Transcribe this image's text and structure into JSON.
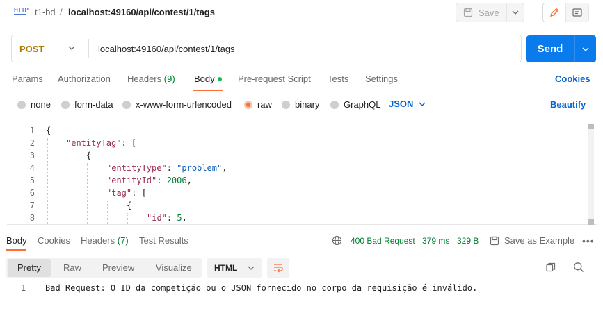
{
  "breadcrumb": {
    "icon_text": "HTTP",
    "collection": "t1-bd",
    "separator": "/",
    "request_url": "localhost:49160/api/contest/1/tags"
  },
  "toolbar": {
    "save_label": "Save"
  },
  "request": {
    "method": "POST",
    "url": "localhost:49160/api/contest/1/tags",
    "send_label": "Send"
  },
  "request_tabs": [
    {
      "label": "Params"
    },
    {
      "label": "Authorization"
    },
    {
      "label": "Headers",
      "count": "(9)"
    },
    {
      "label": "Body",
      "active": true
    },
    {
      "label": "Pre-request Script"
    },
    {
      "label": "Tests"
    },
    {
      "label": "Settings"
    }
  ],
  "cookies_label": "Cookies",
  "body_modes": [
    "none",
    "form-data",
    "x-www-form-urlencoded",
    "raw",
    "binary",
    "GraphQL"
  ],
  "body_mode_selected": "raw",
  "body_format": "JSON",
  "beautify_label": "Beautify",
  "editor": {
    "line_numbers": [
      "1",
      "2",
      "3",
      "4",
      "5",
      "6",
      "7",
      "8"
    ],
    "lines": [
      {
        "parts": [
          {
            "t": "{",
            "c": ""
          }
        ]
      },
      {
        "parts": [
          {
            "t": "\"entityTag\"",
            "c": "k"
          },
          {
            "t": ": [",
            "c": ""
          }
        ]
      },
      {
        "parts": [
          {
            "t": "{",
            "c": ""
          }
        ]
      },
      {
        "parts": [
          {
            "t": "\"entityType\"",
            "c": "k"
          },
          {
            "t": ": ",
            "c": ""
          },
          {
            "t": "\"problem\"",
            "c": "s"
          },
          {
            "t": ",",
            "c": ""
          }
        ]
      },
      {
        "parts": [
          {
            "t": "\"entityId\"",
            "c": "k"
          },
          {
            "t": ": ",
            "c": ""
          },
          {
            "t": "2006",
            "c": "n"
          },
          {
            "t": ",",
            "c": ""
          }
        ]
      },
      {
        "parts": [
          {
            "t": "\"tag\"",
            "c": "k"
          },
          {
            "t": ": [",
            "c": ""
          }
        ]
      },
      {
        "parts": [
          {
            "t": "{",
            "c": ""
          }
        ]
      },
      {
        "parts": [
          {
            "t": "\"id\"",
            "c": "k"
          },
          {
            "t": ": ",
            "c": ""
          },
          {
            "t": "5",
            "c": "n"
          },
          {
            "t": ",",
            "c": ""
          }
        ]
      }
    ]
  },
  "response_tabs": [
    {
      "label": "Body",
      "active": true
    },
    {
      "label": "Cookies"
    },
    {
      "label": "Headers",
      "count": "(7)"
    },
    {
      "label": "Test Results"
    }
  ],
  "response_status": {
    "code": "400 Bad Request",
    "time": "379 ms",
    "size": "329 B"
  },
  "save_example_label": "Save as Example",
  "view_modes": [
    "Pretty",
    "Raw",
    "Preview",
    "Visualize"
  ],
  "view_mode_selected": "Pretty",
  "response_format": "HTML",
  "response_body": {
    "line_number": "1",
    "text": "Bad Request: O ID da competição ou o JSON fornecido no corpo da requisição é inválido."
  },
  "colors": {
    "accent": "#ff6c37",
    "send": "#097bed",
    "link": "#0265d2",
    "method_post": "#ad7a03",
    "status_ok_green": "#007f31"
  }
}
